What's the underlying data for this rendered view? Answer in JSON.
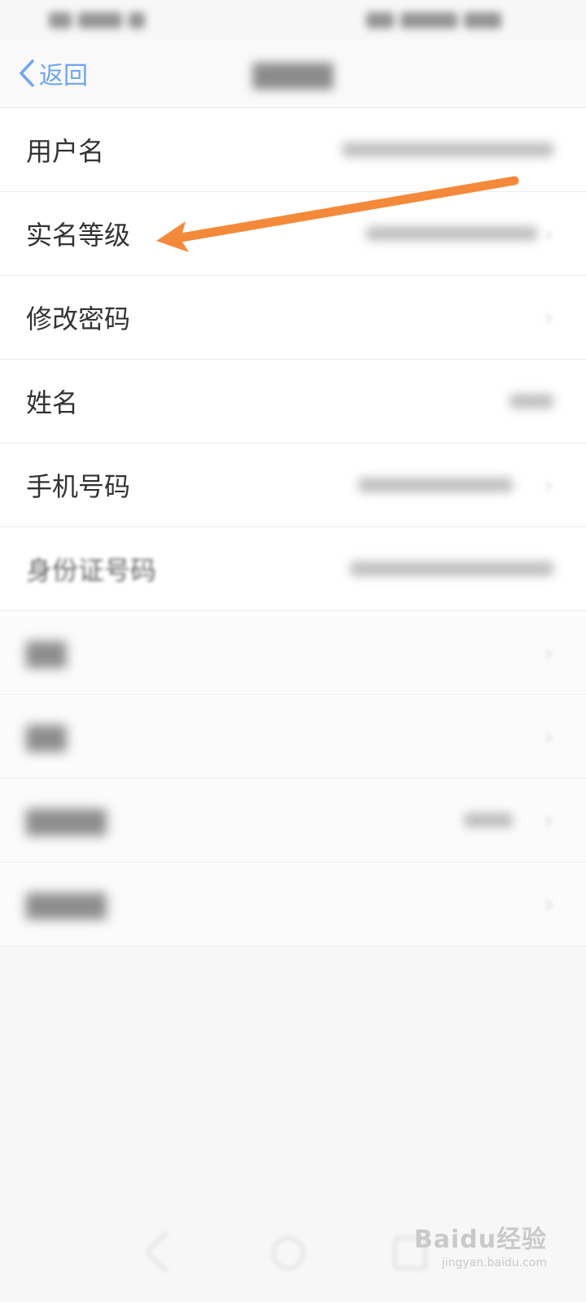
{
  "nav": {
    "back_label": "返回"
  },
  "rows": [
    {
      "label": "用户名"
    },
    {
      "label": "实名等级"
    },
    {
      "label": "修改密码"
    },
    {
      "label": "姓名"
    },
    {
      "label": "手机号码"
    },
    {
      "label": "身份证号码"
    }
  ],
  "blurred_rows_count": 4,
  "annotation": {
    "arrow_color": "#f5893a",
    "target_row": "实名等级"
  },
  "colors": {
    "accent": "#6ea6f0",
    "label": "#333333",
    "divider": "#ececec",
    "background": "#f7f7f7"
  },
  "watermark": {
    "main": "Baidu经验",
    "sub": "jingyan.baidu.com"
  }
}
